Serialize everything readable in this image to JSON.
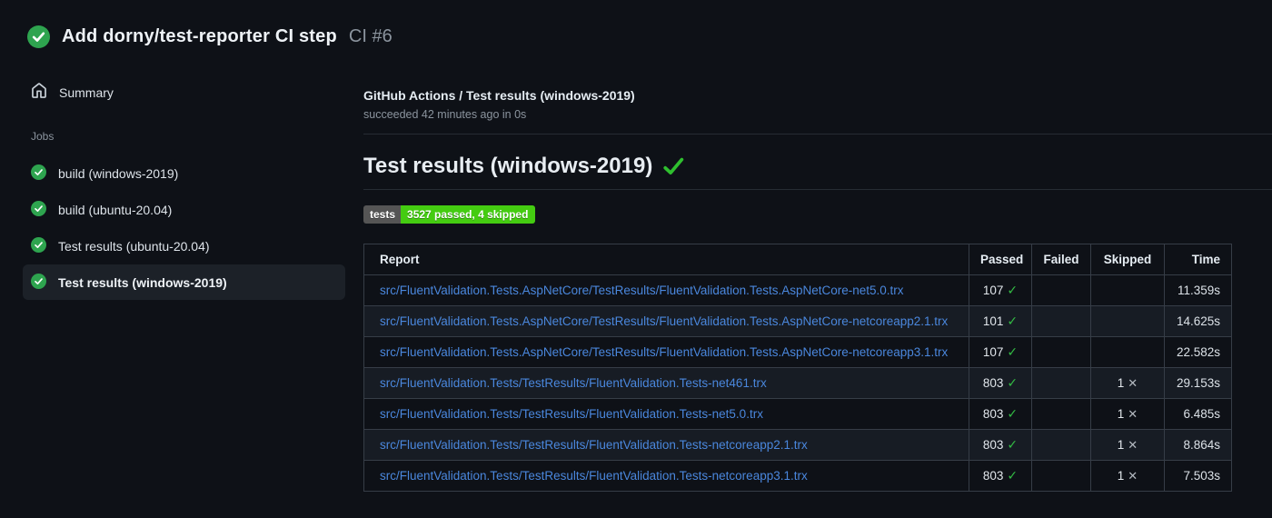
{
  "colors": {
    "background": "#0e1117",
    "accent_green": "#2ea44f",
    "badge_green": "#44cc11",
    "badge_gray": "#555555",
    "link_blue": "#4a87dd",
    "selected_item_bg": "#1c2128"
  },
  "header": {
    "status_icon": "success-check-circle-icon",
    "title": "Add dorny/test-reporter CI step",
    "run_number": "CI #6"
  },
  "sidebar": {
    "summary": {
      "icon": "home-icon",
      "label": "Summary"
    },
    "jobs_label": "Jobs",
    "jobs": [
      {
        "label": "build (windows-2019)",
        "status": "success",
        "selected": false
      },
      {
        "label": "build (ubuntu-20.04)",
        "status": "success",
        "selected": false
      },
      {
        "label": "Test results (ubuntu-20.04)",
        "status": "success",
        "selected": false
      },
      {
        "label": "Test results (windows-2019)",
        "status": "success",
        "selected": true
      }
    ]
  },
  "main": {
    "check_title": "GitHub Actions / Test results (windows-2019)",
    "check_status": "succeeded 42 minutes ago in 0s",
    "report_title": "Test results (windows-2019)",
    "title_check_icon": "success-check-icon",
    "badge": {
      "label": "tests",
      "value": "3527 passed, 4 skipped"
    },
    "glyphs": {
      "pass": "✓",
      "skip": "✕"
    },
    "table": {
      "columns": [
        "Report",
        "Passed",
        "Failed",
        "Skipped",
        "Time"
      ],
      "rows": [
        {
          "report": "src/FluentValidation.Tests.AspNetCore/TestResults/FluentValidation.Tests.AspNetCore-net5.0.trx",
          "passed": "107",
          "failed": "",
          "skipped": "",
          "time": "11.359s"
        },
        {
          "report": "src/FluentValidation.Tests.AspNetCore/TestResults/FluentValidation.Tests.AspNetCore-netcoreapp2.1.trx",
          "passed": "101",
          "failed": "",
          "skipped": "",
          "time": "14.625s"
        },
        {
          "report": "src/FluentValidation.Tests.AspNetCore/TestResults/FluentValidation.Tests.AspNetCore-netcoreapp3.1.trx",
          "passed": "107",
          "failed": "",
          "skipped": "",
          "time": "22.582s"
        },
        {
          "report": "src/FluentValidation.Tests/TestResults/FluentValidation.Tests-net461.trx",
          "passed": "803",
          "failed": "",
          "skipped": "1",
          "time": "29.153s"
        },
        {
          "report": "src/FluentValidation.Tests/TestResults/FluentValidation.Tests-net5.0.trx",
          "passed": "803",
          "failed": "",
          "skipped": "1",
          "time": "6.485s"
        },
        {
          "report": "src/FluentValidation.Tests/TestResults/FluentValidation.Tests-netcoreapp2.1.trx",
          "passed": "803",
          "failed": "",
          "skipped": "1",
          "time": "8.864s"
        },
        {
          "report": "src/FluentValidation.Tests/TestResults/FluentValidation.Tests-netcoreapp3.1.trx",
          "passed": "803",
          "failed": "",
          "skipped": "1",
          "time": "7.503s"
        }
      ]
    }
  }
}
